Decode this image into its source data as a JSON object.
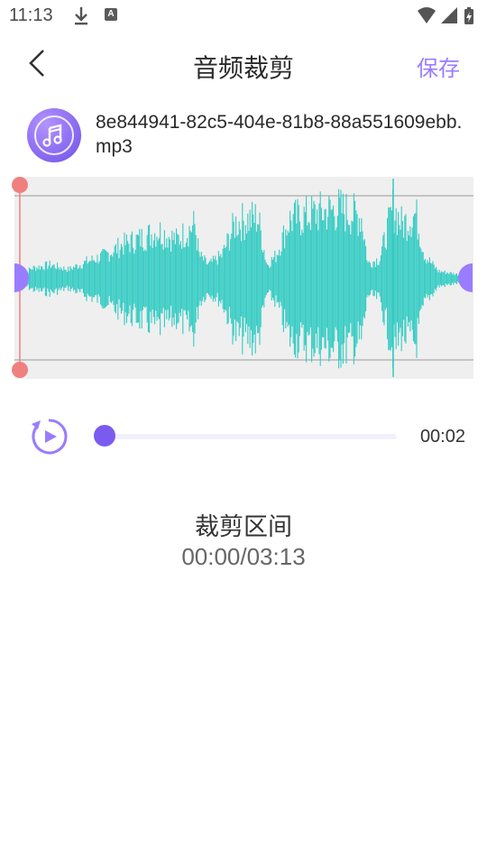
{
  "status_bar": {
    "time": "11:13",
    "download_icon": "download-icon",
    "a_badge": "A",
    "right_icons": [
      "wifi-icon",
      "signal-icon",
      "battery-charging-icon"
    ]
  },
  "header": {
    "back_icon": "chevron-left-icon",
    "title": "音频裁剪",
    "save_label": "保存"
  },
  "file": {
    "icon": "music-note-icon",
    "name": "8e844941-82c5-404e-81b8-88a551609ebb.mp3"
  },
  "waveform": {
    "color": "#33cbc3",
    "background": "#efefef",
    "handle_color": "#f08080",
    "side_handle_color": "#9a7cff"
  },
  "player": {
    "replay_icon": "replay-play-icon",
    "progress": 0,
    "current_time": "00:02",
    "accent": "#7b5bef"
  },
  "range": {
    "label": "裁剪区间",
    "value": "00:00/03:13"
  }
}
